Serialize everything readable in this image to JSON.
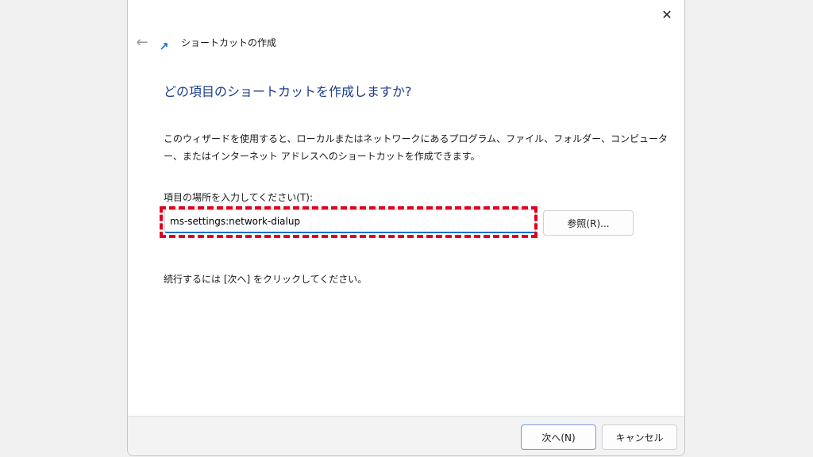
{
  "window": {
    "title": "ショートカットの作成",
    "close_glyph": "✕",
    "back_glyph": "←"
  },
  "main": {
    "heading": "どの項目のショートカットを作成しますか?",
    "description": "このウィザードを使用すると、ローカルまたはネットワークにあるプログラム、ファイル、フォルダー、コンピューター、またはインターネット アドレスへのショートカットを作成できます。",
    "field_label": "項目の場所を入力してください(T):",
    "location_value": "ms-settings:network-dialup",
    "browse_label": "参照(R)...",
    "hint": "続行するには [次へ] をクリックしてください。"
  },
  "footer": {
    "next_label": "次へ(N)",
    "cancel_label": "キャンセル"
  },
  "colors": {
    "heading": "#1c3d8c",
    "highlight": "#e00020",
    "input_accent": "#1a6fd1"
  },
  "icons": {
    "close": "close-icon",
    "back": "back-arrow-icon",
    "wizard": "shortcut-arrow-icon"
  }
}
